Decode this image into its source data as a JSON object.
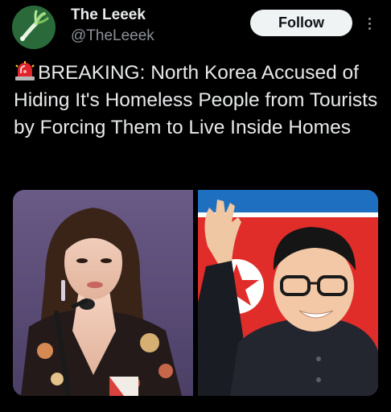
{
  "author": {
    "display_name": "The Leeek",
    "handle": "@TheLeeek",
    "avatar_icon": "leek-icon"
  },
  "actions": {
    "follow_label": "Follow",
    "more_icon": "more-vertical-icon"
  },
  "post": {
    "emoji_icon": "siren-icon",
    "text": "BREAKING: North Korea Accused of Hiding It's Homeless People from Tourists by Forcing Them to Live Inside Homes"
  },
  "media": {
    "images": [
      {
        "icon": "photo-woman-at-microphone"
      },
      {
        "icon": "photo-man-waving-flag"
      }
    ]
  },
  "colors": {
    "background": "#000000",
    "text_primary": "#e7e9ea",
    "text_secondary": "#8b9197",
    "button_bg": "#eff3f4",
    "button_text": "#0f1419"
  }
}
